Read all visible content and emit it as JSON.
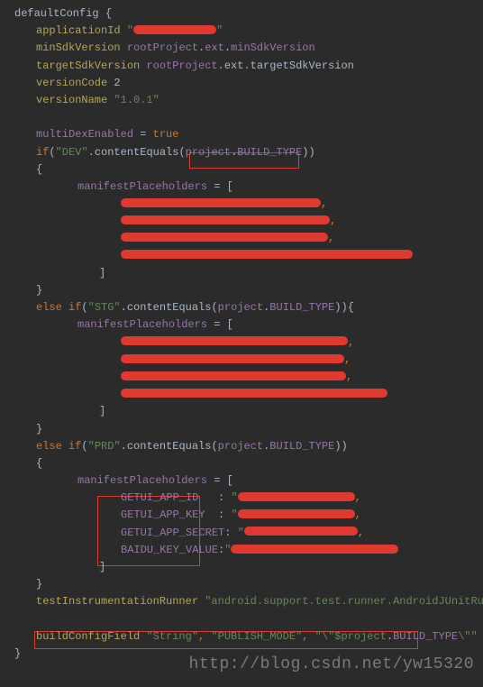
{
  "header": "defaultConfig {",
  "appId_label": "applicationId",
  "appId_q1": "\"",
  "appId_q2": "\"",
  "minSdk_label": "minSdkVersion",
  "minSdk_obj": "rootProject",
  "minSdk_ext": "ext",
  "minSdk_val": "minSdkVersion",
  "tarSdk_label": "targetSdkVersion",
  "tarSdk_obj": "rootProject",
  "tarSdk_ext": "ext",
  "tarSdk_val": "targetSdkVersion",
  "vcode_label": "versionCode",
  "vcode_val": "2",
  "vname_label": "versionName",
  "vname_val": "\"1.0.1\"",
  "multi_label": "multiDexEnabled",
  "multi_eq": " = ",
  "multi_val": "true",
  "if_kw": "if",
  "elseif_kw": "else if",
  "dev_str": "\"DEV\"",
  "stg_str": "\"STG\"",
  "prd_str": "\"PRD\"",
  "dot": ".",
  "contentEquals": "contentEquals",
  "proj": "project",
  "btype": "BUILD_TYPE",
  "close2p": "))",
  "close2pb": ")){",
  "lbrace": "{",
  "rbrace": "}",
  "mp": "manifestPlaceholders",
  "eq_bracket": " = [",
  "rbracket": "]",
  "comma": ",",
  "key1": "GETUI_APP_ID",
  "key2": "GETUI_APP_KEY",
  "key3": "GETUI_APP_SECRET",
  "key4": "BAIDU_KEY_VALUE",
  "colon": ":",
  "sp3": "   ",
  "sp2": "  ",
  "q": "\"",
  "tir_label": "testInstrumentationRunner",
  "tir_val": "\"android.support.test.runner.AndroidJUnitRunner\"",
  "bcf": "buildConfigField",
  "bcf_s1": "\"String\"",
  "bcf_s2": "\"PUBLISH_MODE\"",
  "bcf_s3a": "\"\\\"",
  "bcf_s3b": "$project",
  "bcf_s3c": "BUILD_TYPE",
  "bcf_s3d": "\\\"\"",
  "close_brace": "}",
  "watermark": "http://blog.csdn.net/yw15320"
}
